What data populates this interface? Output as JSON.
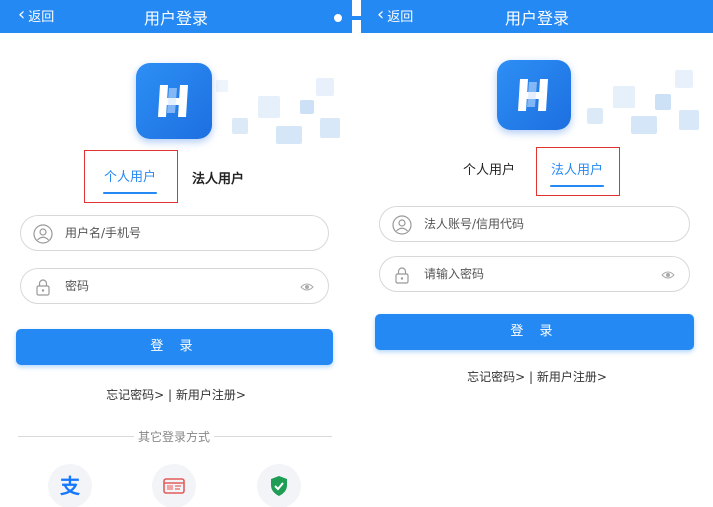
{
  "left": {
    "back_label": "返回",
    "title": "用户登录",
    "tab_personal": "个人用户",
    "tab_legal": "法人用户",
    "username_placeholder": "用户名/手机号",
    "password_placeholder": "密码",
    "login_label": "登 录",
    "links_text": "忘记密码> | 新用户注册>",
    "other_login_label": "其它登录方式",
    "social": [
      "alipay-icon",
      "id-card-icon",
      "shield-check-icon"
    ]
  },
  "right": {
    "back_label": "返回",
    "title": "用户登录",
    "tab_personal": "个人用户",
    "tab_legal": "法人用户",
    "account_placeholder": "法人账号/信用代码",
    "password_placeholder": "请输入密码",
    "login_label": "登 录",
    "links_text": "忘记密码> | 新用户注册>"
  },
  "colors": {
    "primary": "#2589f3",
    "highlight": "#e23333"
  }
}
